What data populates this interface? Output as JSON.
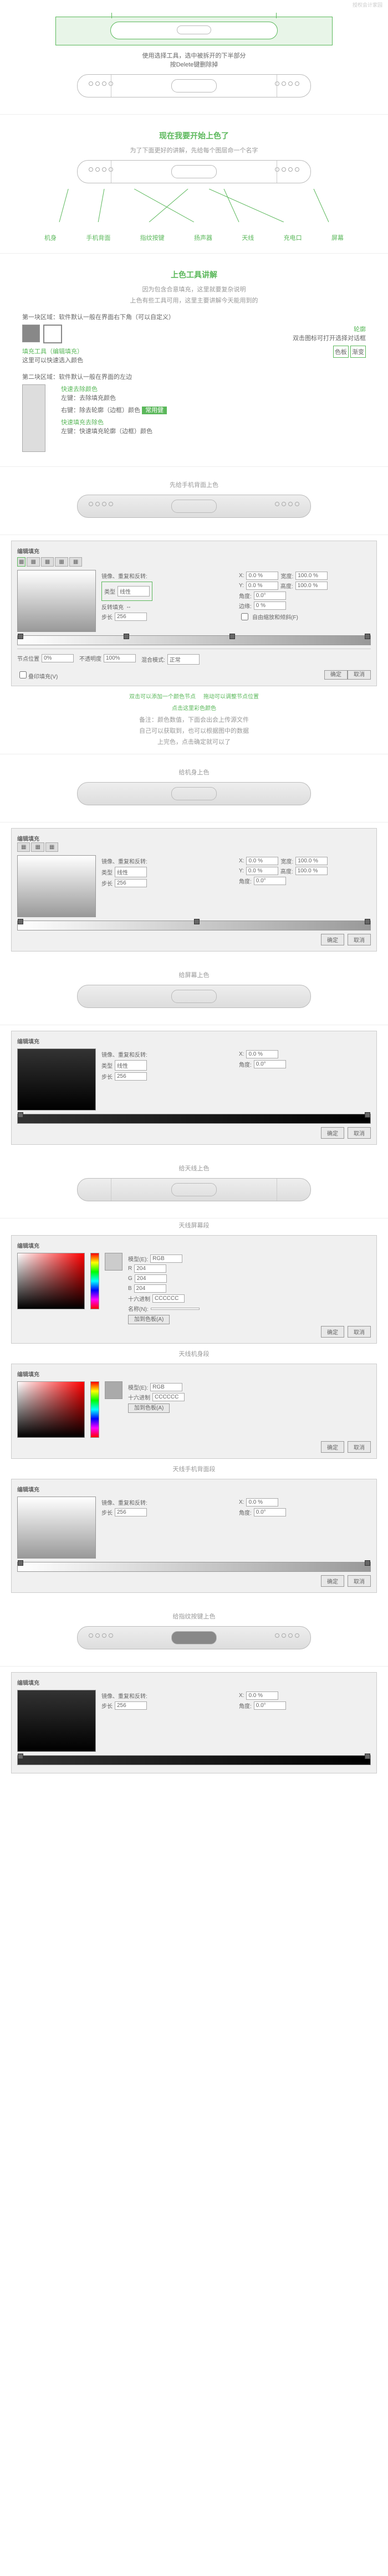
{
  "watermark": "授权会计家园",
  "s1": {
    "text": "使用选择工具，选中被拆开的下半部分",
    "text2": "按Delete键删除掉"
  },
  "s2": {
    "title": "现在我要开始上色了",
    "sub": "为了下面更好的讲解，先给每个图层命一个名字",
    "labels": [
      "机身",
      "手机背面",
      "指纹按键",
      "扬声器",
      "天线",
      "充电口",
      "屏幕"
    ]
  },
  "s3": {
    "title": "上色工具讲解",
    "sub1": "因为包含合意填充，这里就要复杂说明",
    "sub2": "上色有些工具可用，这里主要讲解今天能用到的",
    "box1": "第一块区域：软件默认一般在界面右下角（可以自定义）",
    "sw": {
      "t": "色板",
      "f": "渐变"
    },
    "g1": "填充工具（编辑填充）",
    "g1s": "这里可以快速选入颜色",
    "g2": "轮廓",
    "g2s": "双击图标可打开选择对话框",
    "box2": "第二块区域：软件默认一般在界面的左边",
    "k1": "快速去除颜色",
    "k1d": "左键：去除填充颜色",
    "k2": "右键：除去轮廓（边框）颜色",
    "k2h": "常用健",
    "k3": "快速填充去除色",
    "k3d": "左键：快速填充轮廓（边框）颜色"
  },
  "s4": {
    "title": "先给手机背面上色"
  },
  "grad": {
    "panel": "编辑填充",
    "tabs": [
      "无",
      "均匀",
      "渐变",
      "图样",
      "底纹",
      "PostScript"
    ],
    "type": "类型",
    "typev": "线性",
    "mirror": "镜像、重复和反转:",
    "convert": "反转填充",
    "steps": "步长",
    "angle": "角度:",
    "edge": "边缘:",
    "x": "X:",
    "y": "Y:",
    "w": "宽度:",
    "h": "高度:",
    "stepsv": "256",
    "ok": "确定",
    "cancel": "取消",
    "overprint": "叠印填充(V)",
    "free": "自由缩放和倾斜(F)",
    "node": "节点位置",
    "opacity": "不透明度",
    "mode": "混合模式:",
    "modev": "正常",
    "nodev": "0%",
    "opv": "100%",
    "xv": "0.0 %",
    "yv": "0.0 %",
    "wv": "100.0 %",
    "hv": "100.0 %",
    "av": "0.0°",
    "ev": "0 %"
  },
  "notes": {
    "n1": "双击可以添加一个颜色节点",
    "n2": "拖动可以调整节点位置",
    "n3": "点击这里彩色颜色",
    "n4": "备注：颜色数值，下面会出会上传源文件",
    "n5": "自己可以获取到，也可以根据图中的数据",
    "n6": "上完色，点击确定就可以了"
  },
  "s5": {
    "title": "给机身上色"
  },
  "s6": {
    "title": "给屏幕上色"
  },
  "s7": {
    "title": "给天线上色"
  },
  "r1": {
    "title": "天线屏幕段"
  },
  "r2": {
    "title": "天线机身段"
  },
  "r3": {
    "title": "天线手机背面段"
  },
  "picker": {
    "model": "模型(E):",
    "rgb": "RGB",
    "hex": "十六进制",
    "name": "名称(N):",
    "r": "R",
    "g": "G",
    "b": "B",
    "rv": "204",
    "gv": "204",
    "bv": "204",
    "hexv": "CCCCCC",
    "add": "加到色板(A)"
  },
  "s8": {
    "title": "给指纹按键上色"
  }
}
